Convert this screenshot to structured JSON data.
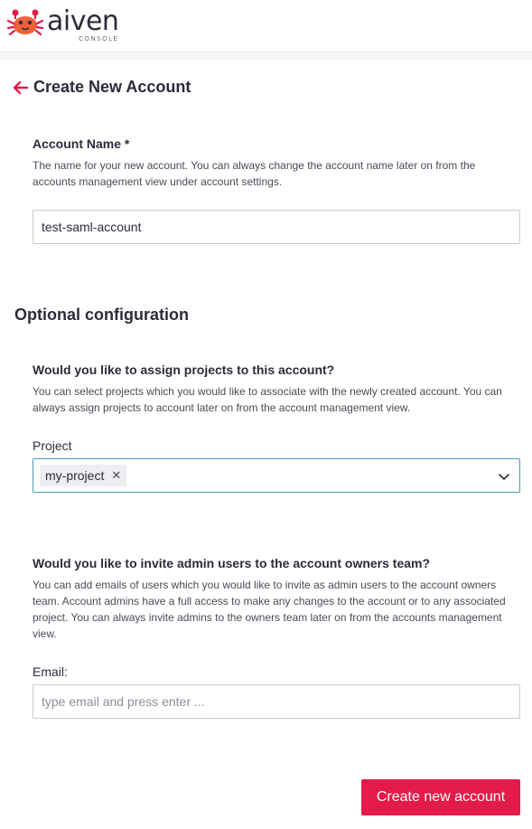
{
  "brand": {
    "name": "aiven",
    "subtitle": "CONSOLE",
    "accent_color": "#e41a4a",
    "logo_icon": "crab-icon"
  },
  "header": {
    "title": "Create New Account",
    "back_icon": "arrow-left-icon"
  },
  "account_name": {
    "label": "Account Name *",
    "help": "The name for your new account. You can always change the account name later on from the accounts management view under account settings.",
    "value": "test-saml-account"
  },
  "optional": {
    "title": "Optional configuration",
    "projects": {
      "question": "Would you like to assign projects to this account?",
      "help": "You can select projects which you would like to associate with the newly created account. You can always assign projects to account later on from the account management view.",
      "field_label": "Project",
      "selected": [
        "my-project"
      ],
      "remove_glyph": "✕",
      "dropdown_icon": "chevron-down-icon"
    },
    "admins": {
      "question": "Would you like to invite admin users to the account owners team?",
      "help": "You can add emails of users which you would like to invite as admin users to the account owners team. Account admins have a full access to make any changes to the account or to any associated project. You can always invite admins to the owners team later on from the accounts management view.",
      "field_label": "Email:",
      "placeholder": "type email and press enter ..."
    }
  },
  "actions": {
    "submit_label": "Create new account"
  }
}
